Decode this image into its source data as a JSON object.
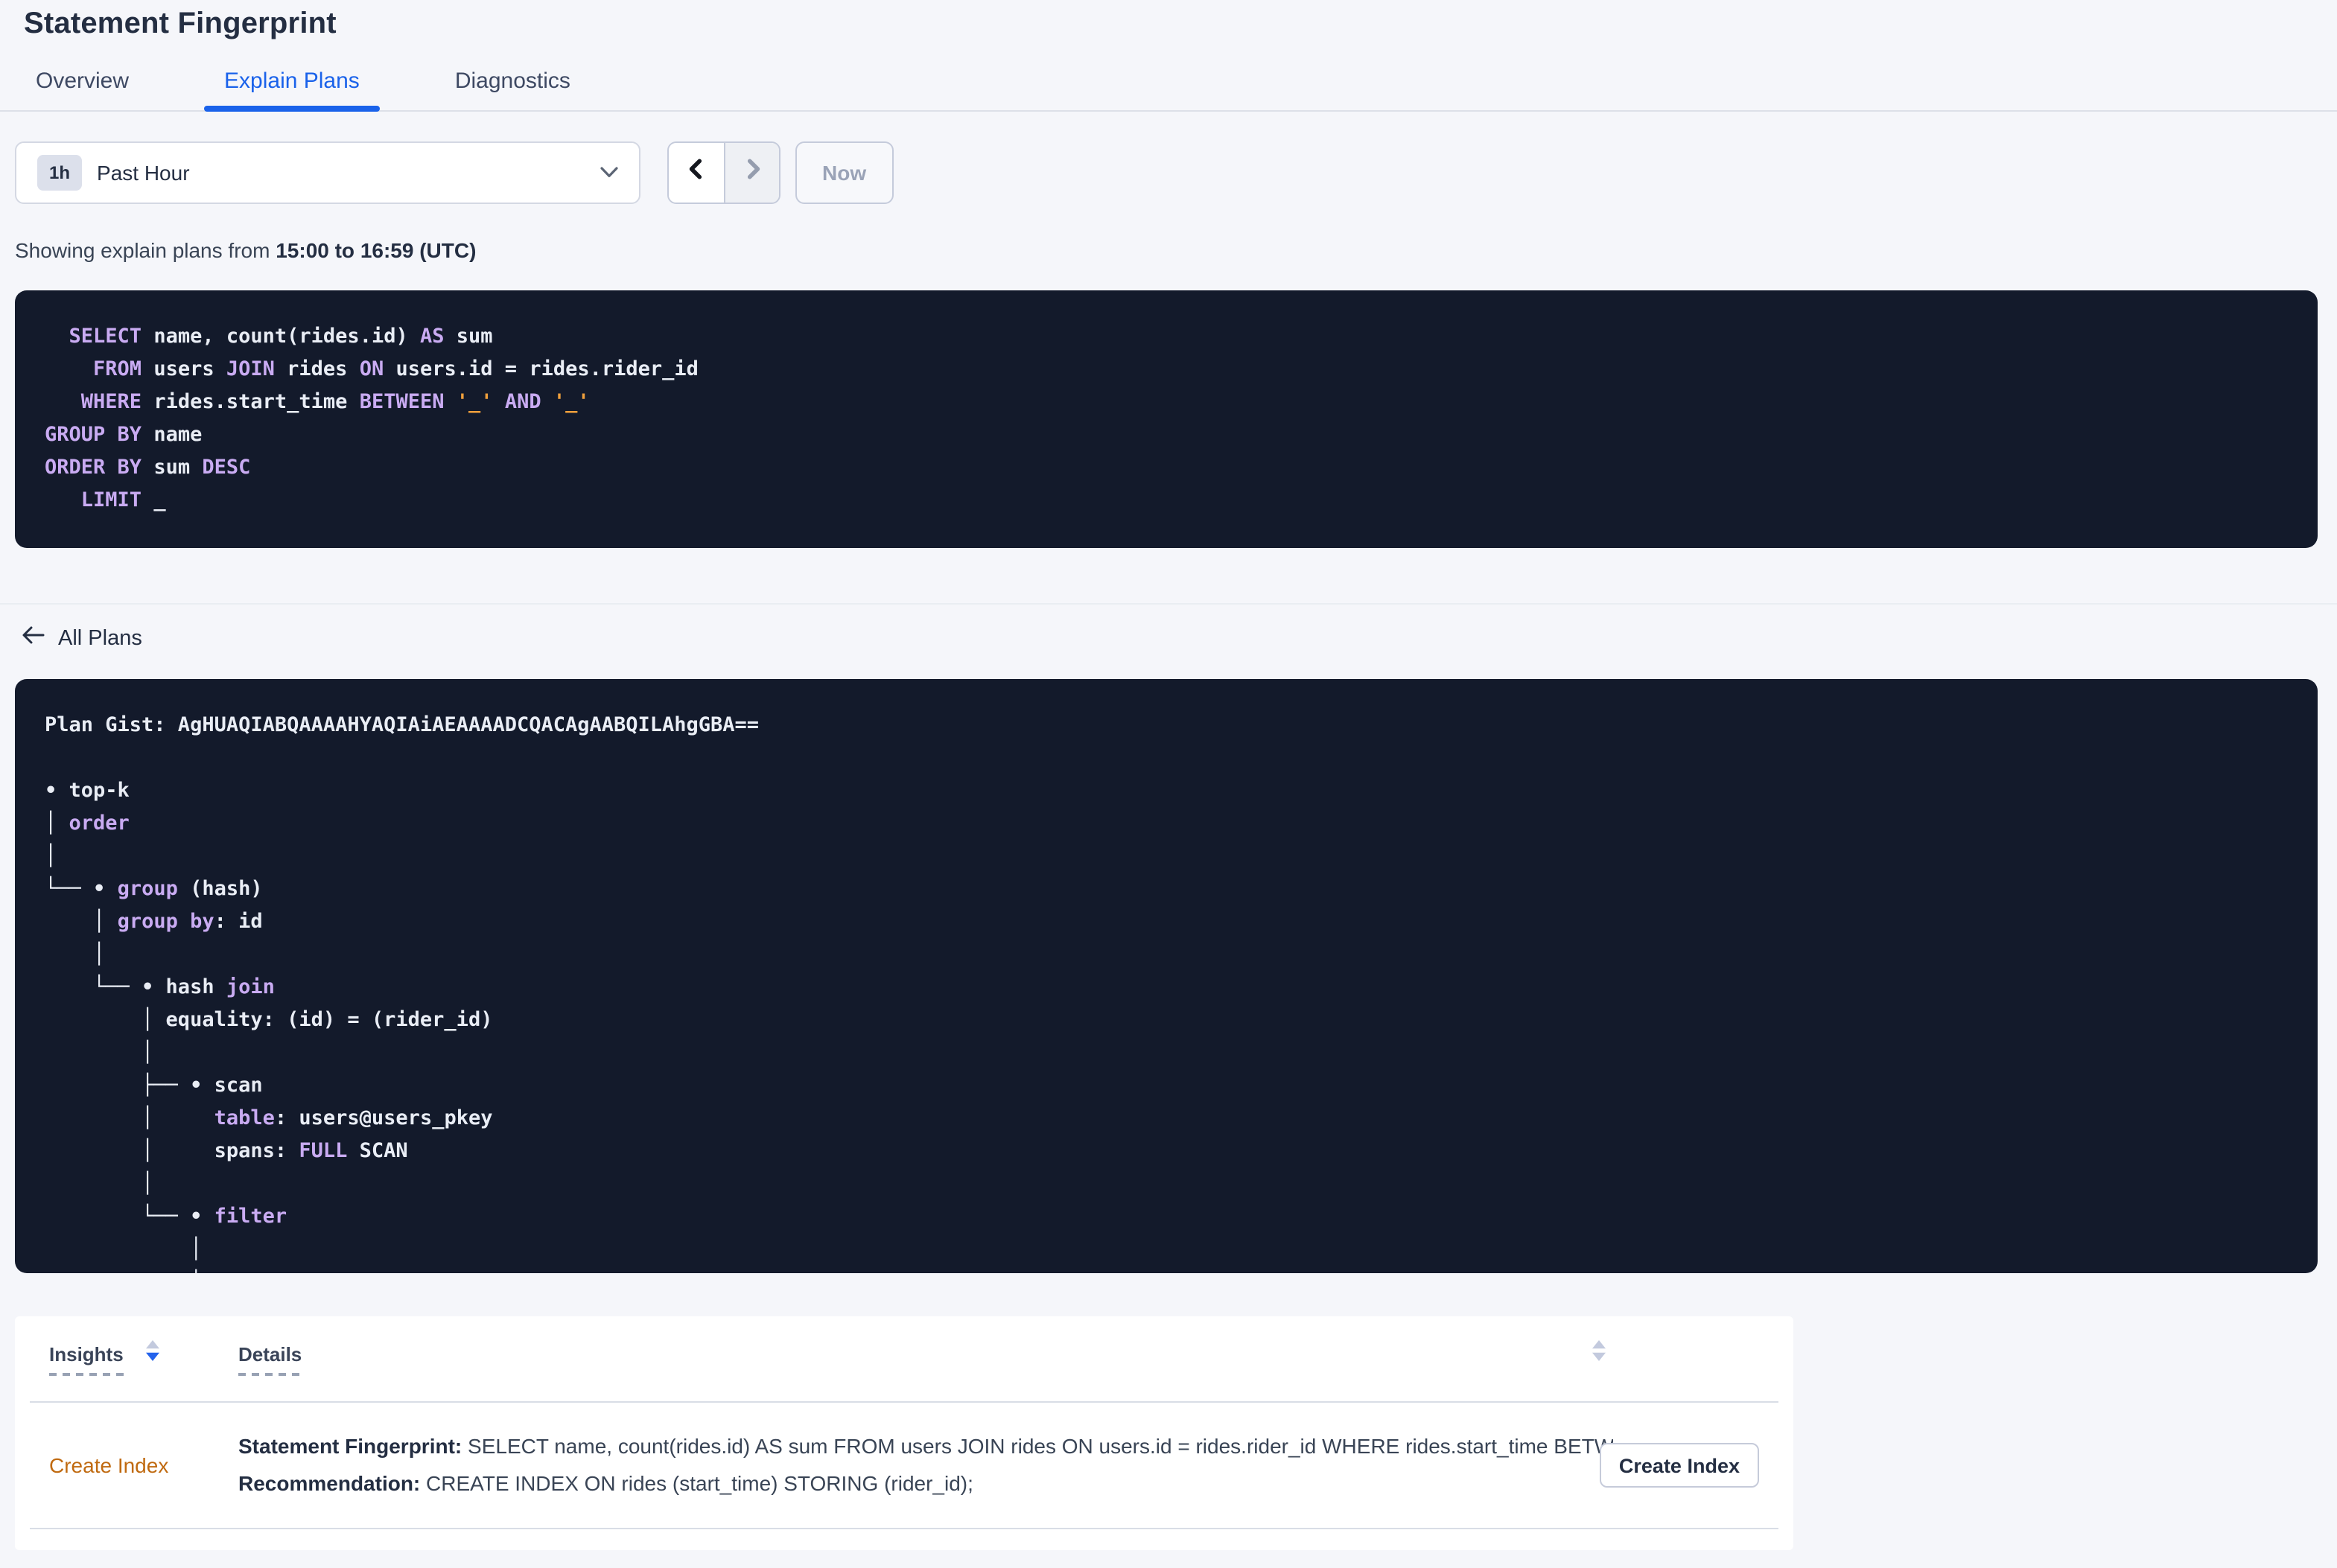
{
  "colors": {
    "page_bg": "#f5f6fa",
    "panel_bg": "#131a2b",
    "accent_blue": "#1a62ea",
    "code_text": "#e9edf5",
    "code_keyword": "#c9abf2",
    "code_string": "#f0a03c",
    "text_primary": "#242e42",
    "text_secondary": "#394455",
    "insight_orange": "#c06a10",
    "disabled_text": "#9aa3b7",
    "sort_active_blue": "#2563eb",
    "sort_inactive_gray": "#c3cade"
  },
  "header": {
    "title": "Statement Fingerprint",
    "tabs": [
      {
        "label": "Overview"
      },
      {
        "label": "Explain Plans"
      },
      {
        "label": "Diagnostics"
      }
    ],
    "active_tab": "Explain Plans"
  },
  "time_picker": {
    "badge": "1h",
    "label": "Past Hour",
    "now_label": "Now"
  },
  "range_text": {
    "prefix": "Showing explain plans from ",
    "range": "15:00 to 16:59 (UTC)"
  },
  "sql": {
    "lines": [
      [
        {
          "t": "  ",
          "c": "w"
        },
        {
          "t": "SELECT",
          "c": "k"
        },
        {
          "t": " name, count(rides.id) ",
          "c": "w"
        },
        {
          "t": "AS",
          "c": "k"
        },
        {
          "t": " sum",
          "c": "w"
        }
      ],
      [
        {
          "t": "    ",
          "c": "w"
        },
        {
          "t": "FROM",
          "c": "k"
        },
        {
          "t": " users ",
          "c": "w"
        },
        {
          "t": "JOIN",
          "c": "k"
        },
        {
          "t": " rides ",
          "c": "w"
        },
        {
          "t": "ON",
          "c": "k"
        },
        {
          "t": " users.id = rides.rider_id",
          "c": "w"
        }
      ],
      [
        {
          "t": "   ",
          "c": "w"
        },
        {
          "t": "WHERE",
          "c": "k"
        },
        {
          "t": " rides.start_time ",
          "c": "w"
        },
        {
          "t": "BETWEEN",
          "c": "k"
        },
        {
          "t": " ",
          "c": "w"
        },
        {
          "t": "'_'",
          "c": "s"
        },
        {
          "t": " ",
          "c": "w"
        },
        {
          "t": "AND",
          "c": "k"
        },
        {
          "t": " ",
          "c": "w"
        },
        {
          "t": "'_'",
          "c": "s"
        }
      ],
      [
        {
          "t": "GROUP BY",
          "c": "k"
        },
        {
          "t": " name",
          "c": "w"
        }
      ],
      [
        {
          "t": "ORDER BY",
          "c": "k"
        },
        {
          "t": " sum ",
          "c": "w"
        },
        {
          "t": "DESC",
          "c": "k"
        }
      ],
      [
        {
          "t": "   ",
          "c": "w"
        },
        {
          "t": "LIMIT",
          "c": "k"
        },
        {
          "t": " _",
          "c": "w"
        }
      ]
    ]
  },
  "back_link": {
    "label": "All Plans"
  },
  "plan": {
    "lines": [
      [
        {
          "t": "Plan Gist: AgHUAQIABQAAAAHYAQIAiAEAAAADCQACAgAABQILAhgGBA==",
          "c": "w"
        }
      ],
      [],
      [
        {
          "t": "• top-k",
          "c": "w"
        }
      ],
      [
        {
          "t": "│ ",
          "c": "w"
        },
        {
          "t": "order",
          "c": "k"
        }
      ],
      [
        {
          "t": "│",
          "c": "w"
        }
      ],
      [
        {
          "t": "└── • ",
          "c": "w"
        },
        {
          "t": "group",
          "c": "k"
        },
        {
          "t": " (hash)",
          "c": "w"
        }
      ],
      [
        {
          "t": "    │ ",
          "c": "w"
        },
        {
          "t": "group by",
          "c": "k"
        },
        {
          "t": ": id",
          "c": "w"
        }
      ],
      [
        {
          "t": "    │",
          "c": "w"
        }
      ],
      [
        {
          "t": "    └── • hash ",
          "c": "w"
        },
        {
          "t": "join",
          "c": "k"
        }
      ],
      [
        {
          "t": "        │ equality: (id) = (rider_id)",
          "c": "w"
        }
      ],
      [
        {
          "t": "        │",
          "c": "w"
        }
      ],
      [
        {
          "t": "        ├── • scan",
          "c": "w"
        }
      ],
      [
        {
          "t": "        │     ",
          "c": "w"
        },
        {
          "t": "table",
          "c": "k"
        },
        {
          "t": ": users@users_pkey",
          "c": "w"
        }
      ],
      [
        {
          "t": "        │     spans: ",
          "c": "w"
        },
        {
          "t": "FULL",
          "c": "k"
        },
        {
          "t": " SCAN",
          "c": "w"
        }
      ],
      [
        {
          "t": "        │",
          "c": "w"
        }
      ],
      [
        {
          "t": "        └── • ",
          "c": "w"
        },
        {
          "t": "filter",
          "c": "k"
        }
      ],
      [
        {
          "t": "            │",
          "c": "w"
        }
      ],
      [
        {
          "t": "            │",
          "c": "w"
        }
      ]
    ]
  },
  "insights_table": {
    "columns": [
      {
        "label": "Insights"
      },
      {
        "label": "Details"
      }
    ],
    "rows": [
      {
        "insight": "Create Index",
        "details": [
          {
            "label": "Statement Fingerprint:",
            "text": " SELECT name, count(rides.id) AS sum FROM users JOIN rides ON users.id = rides.rider_id WHERE rides.start_time BETWEEN '_…"
          },
          {
            "label": "Recommendation:",
            "text": " CREATE INDEX ON rides (start_time) STORING (rider_id);"
          }
        ],
        "action": "Create Index"
      }
    ]
  }
}
